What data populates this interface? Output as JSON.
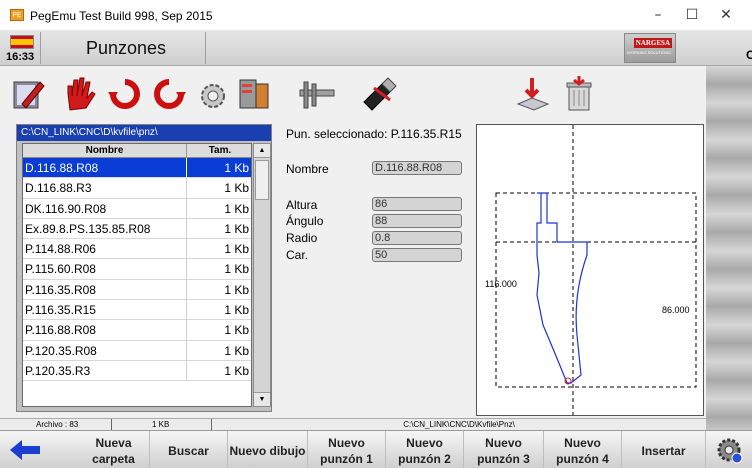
{
  "window": {
    "title": "PegEmu Test Build 998, Sep 2015",
    "minimize": "–",
    "maximize": "☐",
    "close": "✕"
  },
  "header": {
    "time": "16:33",
    "title": "Punzones",
    "brand": "NARGESA",
    "brand_sub": "WORKING SOLUTIONS",
    "edge_letter": "C"
  },
  "toolbar": {
    "icons": [
      "edit-icon",
      "stop-hand-icon",
      "refresh-cw-icon",
      "refresh-ccw-icon",
      "tool-settings-icon",
      "punch-tool-icon",
      "caliper-icon",
      "usb-drive-icon",
      "import-icon",
      "trash-icon"
    ]
  },
  "file_panel": {
    "path": "C:\\CN_LINK\\CNC\\D\\kvfile\\pnz\\",
    "columns": [
      "Nombre",
      "Tam."
    ],
    "rows": [
      {
        "name": "D.116.88.R08",
        "size": "1 Kb"
      },
      {
        "name": "D.116.88.R3",
        "size": "1 Kb"
      },
      {
        "name": "DK.116.90.R08",
        "size": "1 Kb"
      },
      {
        "name": "Ex.89.8.PS.135.85.R08",
        "size": "1 Kb"
      },
      {
        "name": "P.114.88.R06",
        "size": "1 Kb"
      },
      {
        "name": "P.115.60.R08",
        "size": "1 Kb"
      },
      {
        "name": "P.116.35.R08",
        "size": "1 Kb"
      },
      {
        "name": "P.116.35.R15",
        "size": "1 Kb"
      },
      {
        "name": "P.116.88.R08",
        "size": "1 Kb"
      },
      {
        "name": "P.120.35.R08",
        "size": "1 Kb"
      },
      {
        "name": "P.120.35.R3",
        "size": "1 Kb"
      }
    ],
    "selected_index": 0,
    "scroll_up": "▲",
    "scroll_down": "▼"
  },
  "details": {
    "selected_label": "Pun. seleccionado: P.116.35.R15",
    "nombre_label": "Nombre",
    "nombre_value": "D.116.88.R08",
    "altura_label": "Altura",
    "altura_value": "86",
    "angulo_label": "Ángulo",
    "angulo_value": "88",
    "radio_label": "Radio",
    "radio_value": "0.8",
    "car_label": "Car.",
    "car_value": "50"
  },
  "drawing": {
    "height_label": "116.000",
    "width_label": "86.000"
  },
  "status": {
    "archivo": "Archivo : 83",
    "size": "1 KB",
    "path": "C:\\CN_LINK\\CNC\\D\\Kvfile\\Pnz\\"
  },
  "bottom_buttons": [
    {
      "label": "Nueva carpeta",
      "name": "nueva-carpeta-button"
    },
    {
      "label": "Buscar",
      "name": "buscar-button"
    },
    {
      "label": "Nuevo dibujo",
      "name": "nuevo-dibujo-button"
    },
    {
      "label": "Nuevo punzón 1",
      "name": "nuevo-punzon-1-button"
    },
    {
      "label": "Nuevo punzón 2",
      "name": "nuevo-punzon-2-button"
    },
    {
      "label": "Nuevo punzón 3",
      "name": "nuevo-punzon-3-button"
    },
    {
      "label": "Nuevo punzón 4",
      "name": "nuevo-punzon-4-button"
    },
    {
      "label": "Insertar",
      "name": "insertar-button"
    }
  ],
  "colors": {
    "selection": "#0a3cd6",
    "path_bar": "#1a3fb0",
    "profile_line": "#1a32d8",
    "brand": "#c01818"
  }
}
